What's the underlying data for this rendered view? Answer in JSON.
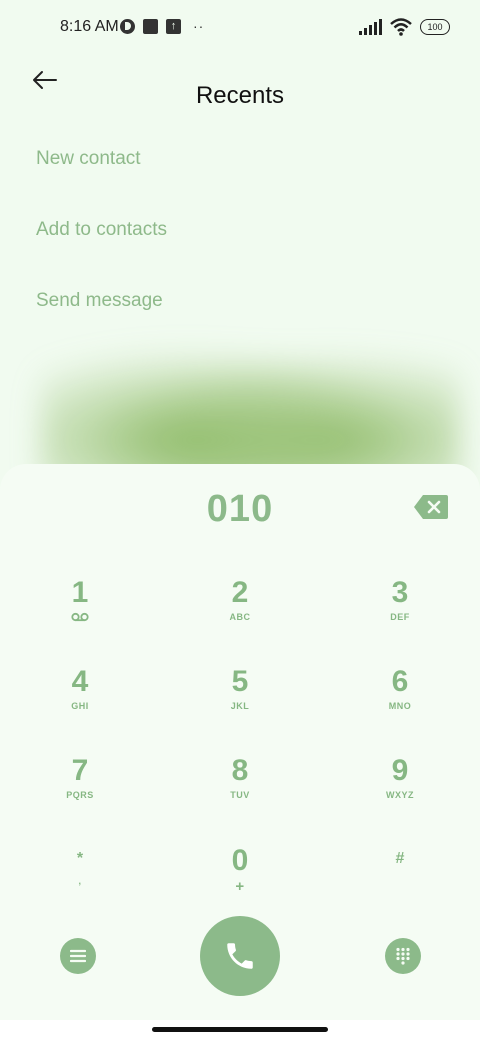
{
  "status_bar": {
    "time": "8:16 AM",
    "battery": "100",
    "dots": "··"
  },
  "header": {
    "title": "Recents"
  },
  "actions": [
    "New contact",
    "Add to contacts",
    "Send message"
  ],
  "dialer": {
    "number": "010"
  },
  "keys": [
    {
      "digit": "1",
      "letters": ""
    },
    {
      "digit": "2",
      "letters": "ABC"
    },
    {
      "digit": "3",
      "letters": "DEF"
    },
    {
      "digit": "4",
      "letters": "GHI"
    },
    {
      "digit": "5",
      "letters": "JKL"
    },
    {
      "digit": "6",
      "letters": "MNO"
    },
    {
      "digit": "7",
      "letters": "PQRS"
    },
    {
      "digit": "8",
      "letters": "TUV"
    },
    {
      "digit": "9",
      "letters": "WXYZ"
    },
    {
      "digit": "*",
      "letters": ","
    },
    {
      "digit": "0",
      "letters": "+"
    },
    {
      "digit": "#",
      "letters": ""
    }
  ],
  "icons": {
    "back": "arrow-left-icon",
    "backspace": "backspace-icon",
    "voicemail": "voicemail-icon",
    "menu": "menu-icon",
    "call": "phone-icon",
    "keypad": "dialpad-icon"
  },
  "colors": {
    "accent": "#8cba8a",
    "background": "#f1fbf0",
    "text_muted": "#8eb98a"
  }
}
